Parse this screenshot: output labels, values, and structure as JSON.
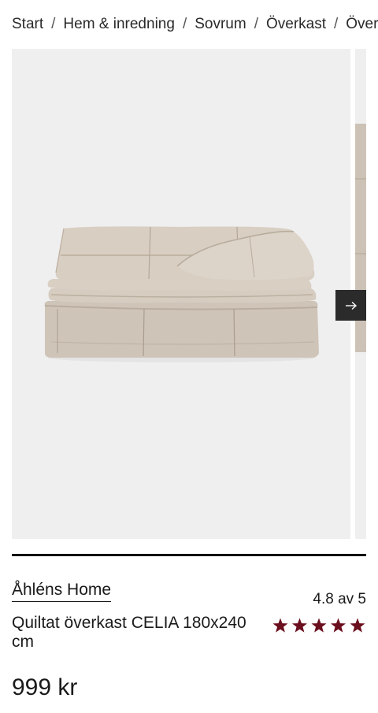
{
  "breadcrumb": {
    "items": [
      "Start",
      "Hem & inredning",
      "Sovrum",
      "Överkast",
      "Överkast"
    ],
    "separator": "/"
  },
  "gallery": {
    "next_icon": "arrow-right-icon",
    "background": "#efefef",
    "button_color": "#2b2b2b"
  },
  "product": {
    "brand": "Åhléns Home",
    "title": "Quiltat överkast CELIA 180x240 cm",
    "rating_text": "4.8 av 5",
    "rating_value": 4.8,
    "rating_max": 5,
    "star_color": "#6b0f1e",
    "price": "999 kr"
  }
}
